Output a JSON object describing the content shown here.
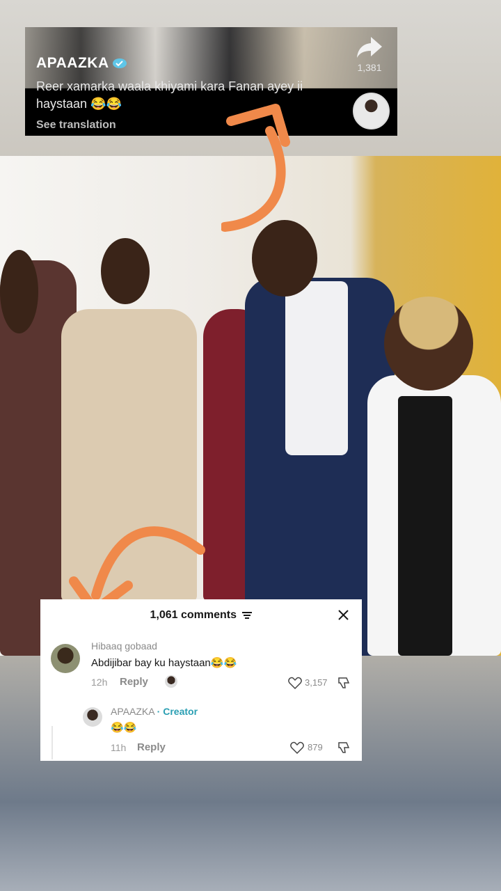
{
  "post": {
    "username": "APAAZKA",
    "caption": "Reer xamarka waala khiyami kara Fanan ayey ii haystaan 😂😂",
    "see_translation": "See translation",
    "share_count": "1,381"
  },
  "comments": {
    "header": "1,061 comments",
    "items": [
      {
        "author": "Hibaaq gobaad",
        "text": "Abdijibar bay ku haystaan😂😂",
        "time": "12h",
        "reply_label": "Reply",
        "likes": "3,157"
      },
      {
        "author": "APAAZKA",
        "creator_label": "· Creator",
        "text": "😂😂",
        "time": "11h",
        "reply_label": "Reply",
        "likes": "879"
      }
    ]
  },
  "colors": {
    "arrow": "#f0894a",
    "creator_tag": "#2a9fb3"
  },
  "icons": [
    "share-icon",
    "verified-icon",
    "filter-icon",
    "close-icon",
    "heart-icon",
    "dislike-icon"
  ]
}
